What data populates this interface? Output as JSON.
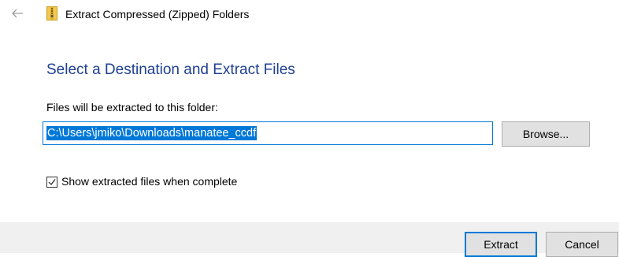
{
  "window": {
    "title": "Extract Compressed (Zipped) Folders",
    "back_icon": "back-arrow-icon",
    "app_icon": "zip-folder-icon"
  },
  "main": {
    "heading": "Select a Destination and Extract Files",
    "folder_label": "Files will be extracted to this folder:",
    "destination_path": "C:\\Users\\jmiko\\Downloads\\manatee_ccdf",
    "browse_label": "Browse...",
    "show_files_label": "Show extracted files when complete",
    "show_files_checked": true
  },
  "footer": {
    "extract_label": "Extract",
    "cancel_label": "Cancel"
  },
  "colors": {
    "heading": "#1e3f92",
    "accent": "#0078d7",
    "footer_bg": "#f0f0f0",
    "button_bg": "#e1e1e1"
  }
}
